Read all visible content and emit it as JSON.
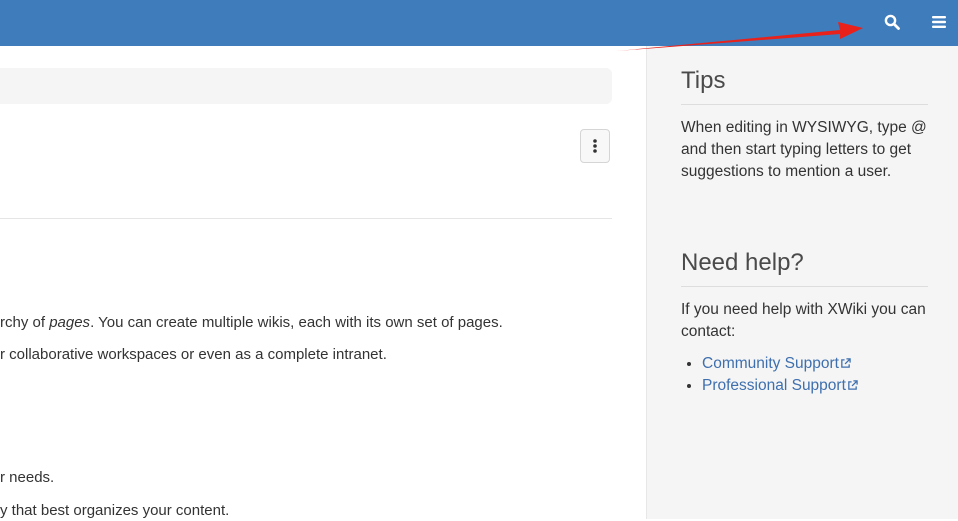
{
  "header": {
    "search_icon": "search-icon",
    "menu_icon": "hamburger-menu-icon",
    "background_color": "#3e7cbc"
  },
  "annotation": {
    "arrow_color": "#e8211b"
  },
  "main": {
    "actions_icon": "vertical-ellipsis-icon",
    "lines": [
      {
        "before": "rchy of ",
        "em": "pages",
        "after": ". You can create multiple wikis, each with its own set of pages."
      },
      {
        "text": "r collaborative workspaces or even as a complete intranet."
      },
      {
        "text": "r needs."
      },
      {
        "text": "y that best organizes your content."
      }
    ]
  },
  "sidebar": {
    "tips": {
      "title": "Tips",
      "body": "When editing in WYSIWYG, type @ and then start typing letters to get suggestions to mention a user."
    },
    "help": {
      "title": "Need help?",
      "body": "If you need help with XWiki you can contact:",
      "links": [
        {
          "label": "Community Support"
        },
        {
          "label": "Professional Support"
        }
      ]
    },
    "link_color": "#3e6fae"
  }
}
